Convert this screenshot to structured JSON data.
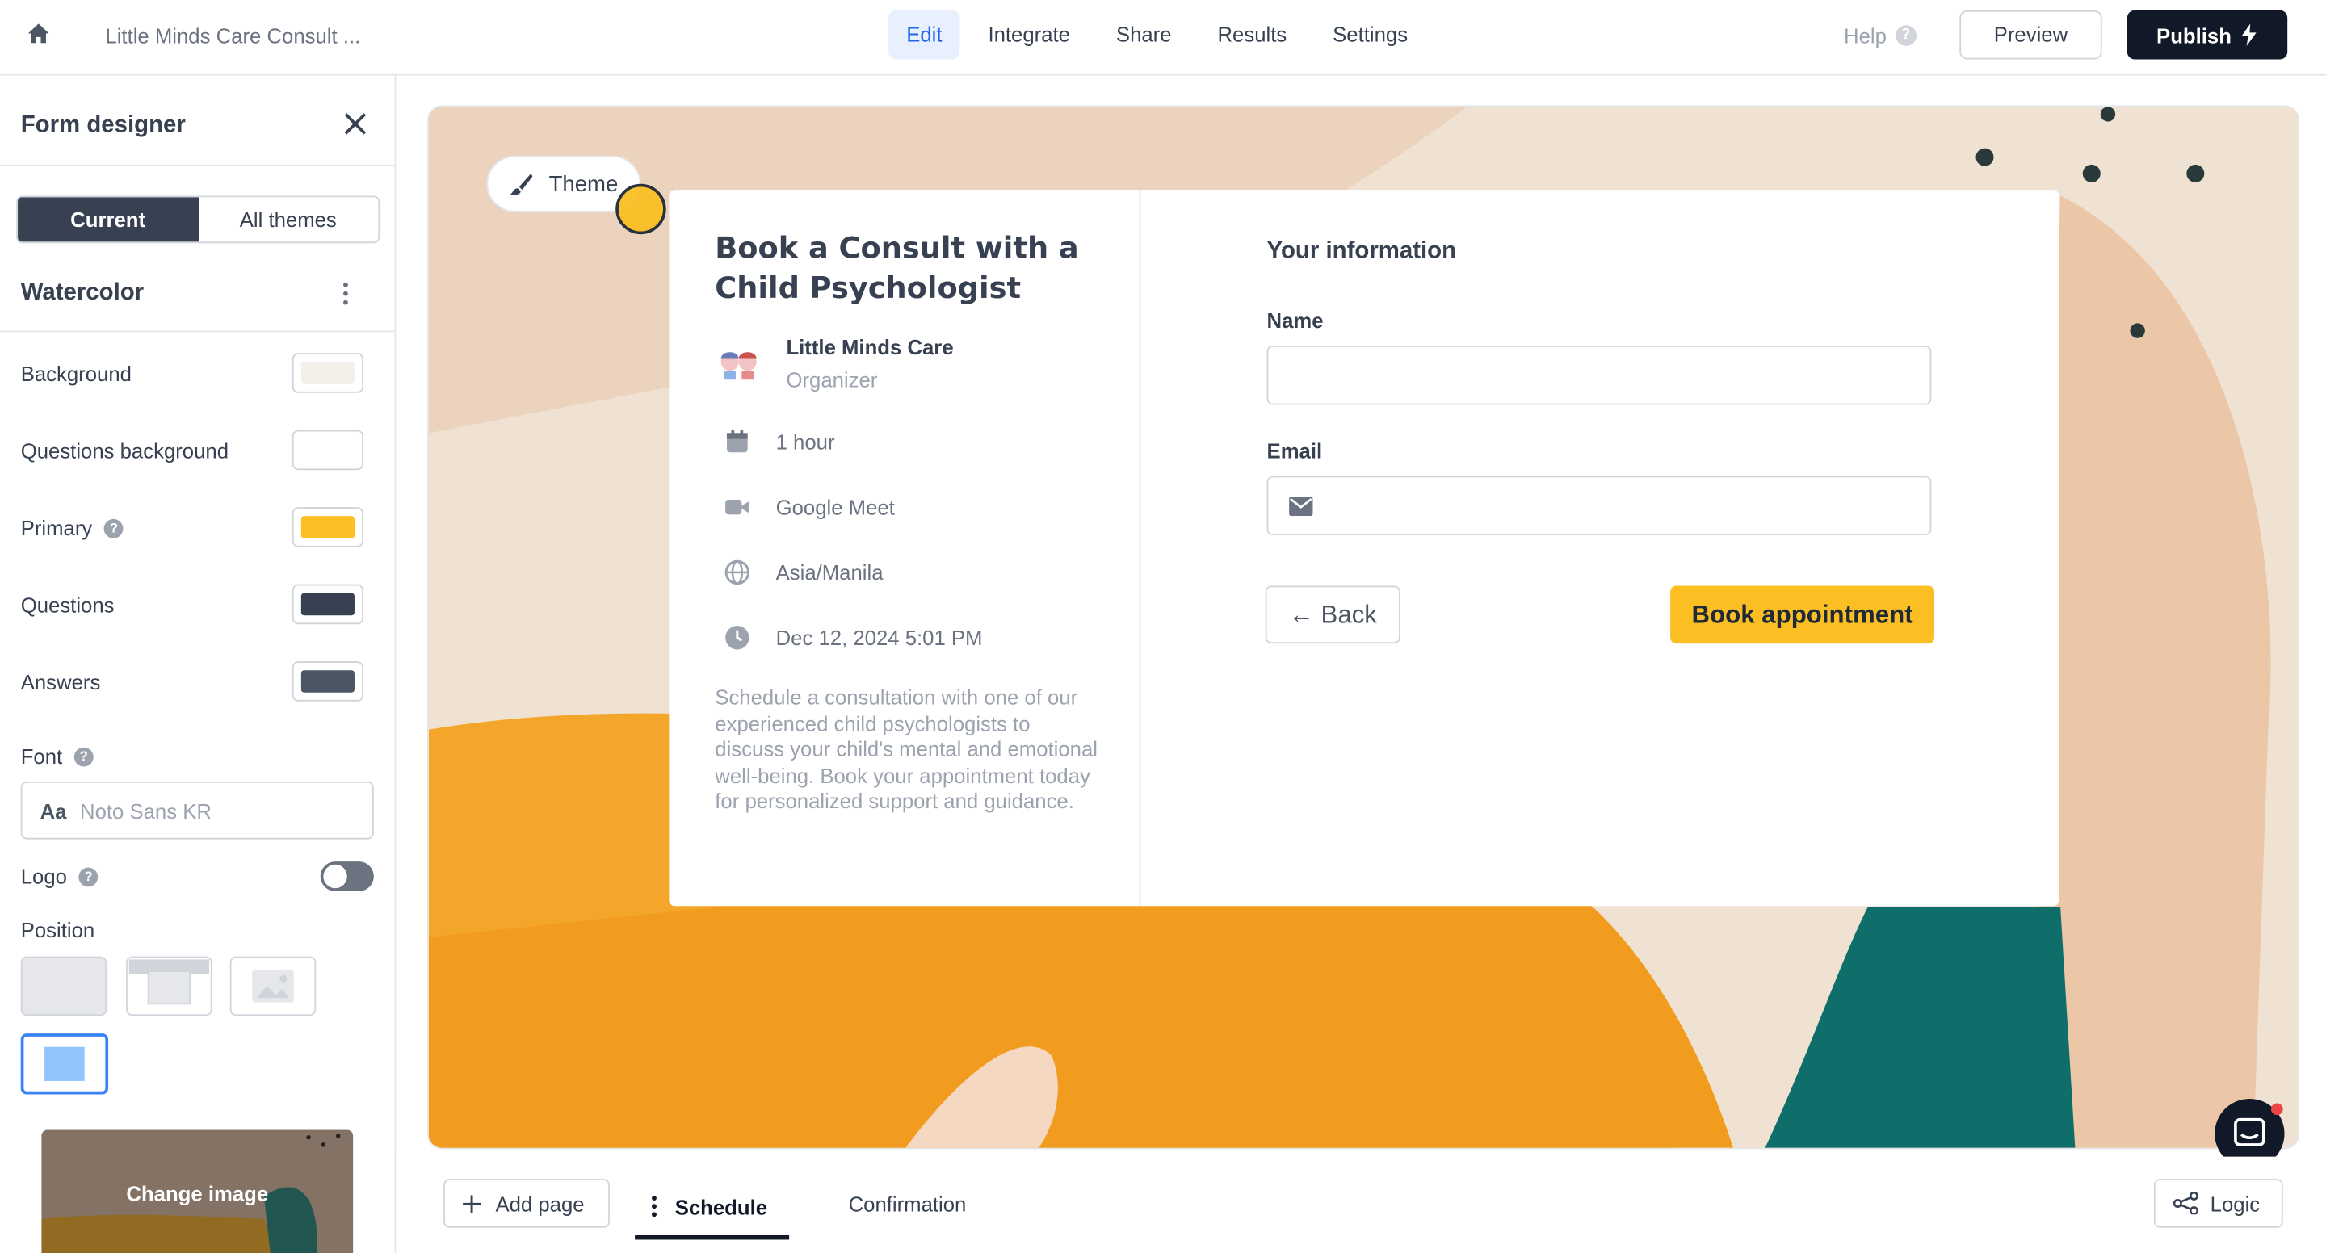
{
  "topbar": {
    "breadcrumb": "Little Minds Care Consult ...",
    "nav": [
      "Edit",
      "Integrate",
      "Share",
      "Results",
      "Settings"
    ],
    "active_nav": "Edit",
    "help": "Help",
    "preview": "Preview",
    "publish": "Publish"
  },
  "sidebar": {
    "title": "Form designer",
    "segment": [
      "Current",
      "All themes"
    ],
    "theme_name": "Watercolor",
    "colors": [
      {
        "label": "Background",
        "value": "#f3efe9"
      },
      {
        "label": "Questions background",
        "value": "#ffffff"
      },
      {
        "label": "Primary",
        "value": "#fbbf24"
      },
      {
        "label": "Questions",
        "value": "#374151"
      },
      {
        "label": "Answers",
        "value": "#4b5563"
      }
    ],
    "font_label": "Font",
    "font_aa": "Aa",
    "font_value": "Noto Sans KR",
    "logo_label": "Logo",
    "position_label": "Position",
    "change_image": "Change image"
  },
  "canvas": {
    "theme_button": "Theme",
    "card": {
      "title": "Book a Consult with a Child Psychologist",
      "organizer_name": "Little Minds Care",
      "organizer_role": "Organizer",
      "duration": "1 hour",
      "location": "Google Meet",
      "timezone": "Asia/Manila",
      "datetime": "Dec 12, 2024 5:01 PM",
      "description": "Schedule a consultation with one of our experienced child psychologists to discuss your child's mental and emotional well-being. Book your appointment today for personalized support and guidance.",
      "section_title": "Your information",
      "name_label": "Name",
      "email_label": "Email",
      "back": "← Back",
      "book": "Book appointment"
    }
  },
  "bottombar": {
    "add_page": "Add page",
    "tabs": [
      "Schedule",
      "Confirmation"
    ],
    "logic": "Logic"
  }
}
